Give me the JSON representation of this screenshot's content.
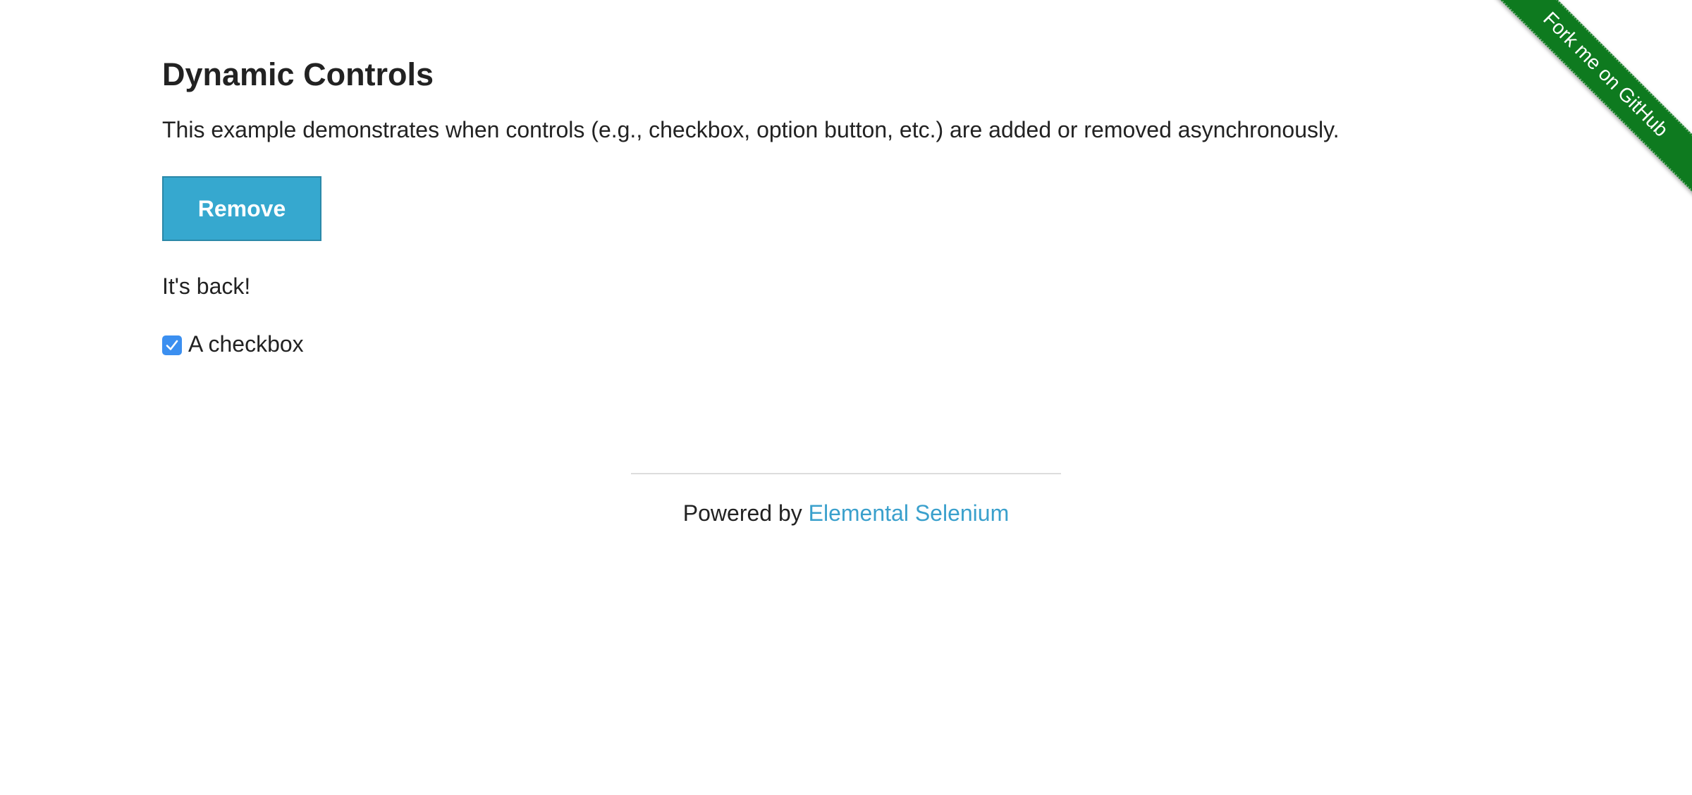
{
  "page": {
    "title": "Dynamic Controls",
    "description": "This example demonstrates when controls (e.g., checkbox, option button, etc.) are added or removed asynchronously."
  },
  "controls": {
    "remove_button_label": "Remove",
    "message": "It's back!",
    "checkbox": {
      "label": "A checkbox",
      "checked": true,
      "check_color": "#3b8ff0"
    }
  },
  "footer": {
    "prefix": "Powered by ",
    "link_text": "Elemental Selenium",
    "link_color": "#3aa0cc"
  },
  "ribbon": {
    "label": "Fork me on GitHub",
    "color": "#0e7a1f"
  },
  "colors": {
    "button_bg": "#36a8cf",
    "text": "#222222"
  }
}
